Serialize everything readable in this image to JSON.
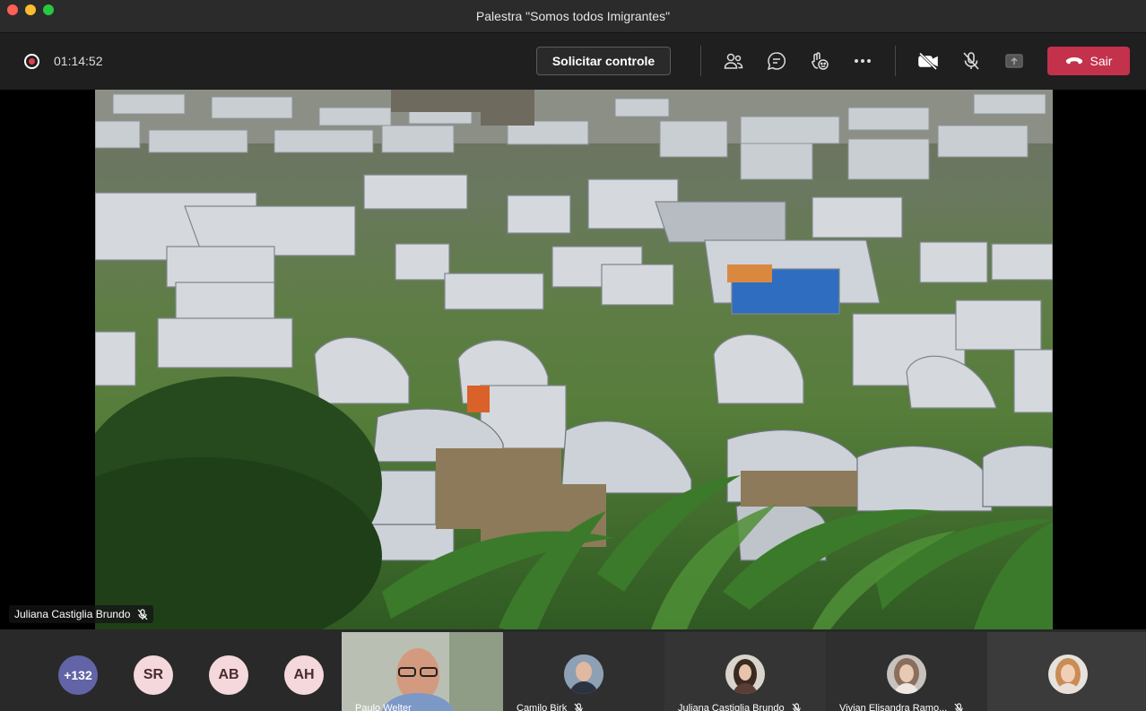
{
  "window": {
    "title": "Palestra \"Somos todos Imigrantes\""
  },
  "toolbar": {
    "timer": "01:14:52",
    "request_control_label": "Solicitar controle",
    "leave_label": "Sair",
    "icons": [
      "people-icon",
      "chat-icon",
      "reactions-icon",
      "more-options-icon",
      "camera-off-icon",
      "mic-off-icon",
      "share-tray-icon",
      "hang-up-icon"
    ]
  },
  "stage": {
    "speaker_name": "Juliana Castiglia Brundo"
  },
  "participants": {
    "overflow_count": "+132",
    "initials": [
      "SR",
      "AB",
      "AH"
    ],
    "tiles": [
      {
        "name": "Paulo Welter"
      },
      {
        "name": "Camilo Birk"
      },
      {
        "name": "Juliana Castiglia Brundo"
      },
      {
        "name": "Vivian Elisandra Ramo..."
      }
    ]
  },
  "colors": {
    "leave_button": "#c4314b",
    "overflow_badge": "#6264a7",
    "recording": "#e03e4c"
  }
}
